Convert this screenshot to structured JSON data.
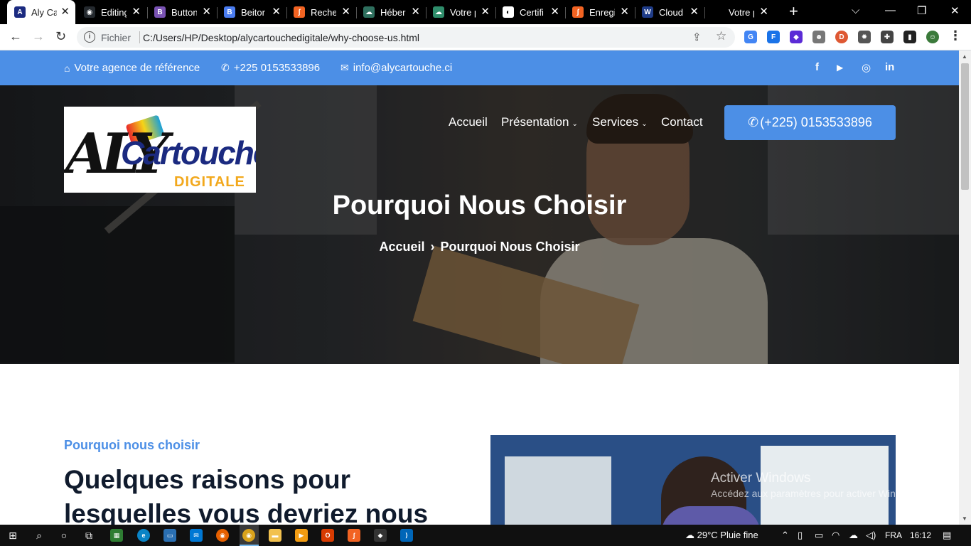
{
  "browser": {
    "tabs": [
      {
        "title": "Aly Ca",
        "favicon_color": "#1b2a80",
        "favicon_glyph": "A",
        "active": true
      },
      {
        "title": "Editing",
        "favicon_color": "#24292e",
        "favicon_glyph": "◉",
        "active": false
      },
      {
        "title": "Button",
        "favicon_color": "#7952b3",
        "favicon_glyph": "B",
        "active": false
      },
      {
        "title": "Beitor",
        "favicon_color": "#4a7cf0",
        "favicon_glyph": "B",
        "active": false
      },
      {
        "title": "Recher",
        "favicon_color": "#f26322",
        "favicon_glyph": "ʃ",
        "active": false
      },
      {
        "title": "Héber",
        "favicon_color": "#2e6f5e",
        "favicon_glyph": "☁",
        "active": false
      },
      {
        "title": "Votre p",
        "favicon_color": "#2f8d6b",
        "favicon_glyph": "☁",
        "active": false
      },
      {
        "title": "Certifi",
        "favicon_color": "#ffffff",
        "favicon_glyph": "◐",
        "active": false
      },
      {
        "title": "Enregi",
        "favicon_color": "#f26322",
        "favicon_glyph": "ʃ",
        "active": false
      },
      {
        "title": "Cloud",
        "favicon_color": "#1f3c88",
        "favicon_glyph": "W",
        "active": false
      },
      {
        "title": "Votre p",
        "favicon_color": "#000000",
        "favicon_glyph": "",
        "active": false
      }
    ],
    "new_tab_glyph": "+",
    "window_controls": [
      "chevron-down",
      "minimize",
      "restore",
      "close"
    ],
    "omnibox": {
      "protocol": "Fichier",
      "url": "C:/Users/HP/Desktop/alycartouchedigitale/why-choose-us.html"
    },
    "extensions": [
      {
        "name": "translate-icon",
        "color": "#4285f4",
        "glyph": "G"
      },
      {
        "name": "flow-icon",
        "color": "#1a73e8",
        "glyph": "F"
      },
      {
        "name": "layers-icon",
        "color": "#5b2bd6",
        "glyph": "◆"
      },
      {
        "name": "face-icon",
        "color": "#777777",
        "glyph": "☻"
      },
      {
        "name": "duckduckgo-icon",
        "color": "#de5833",
        "glyph": "D"
      },
      {
        "name": "settings-ext-icon",
        "color": "#555555",
        "glyph": "✹"
      },
      {
        "name": "puzzle-icon",
        "color": "#444444",
        "glyph": "✚"
      },
      {
        "name": "sidepanel-icon",
        "color": "#222222",
        "glyph": "▮"
      },
      {
        "name": "profile-icon",
        "color": "#3b7a3b",
        "glyph": "☺"
      }
    ]
  },
  "site": {
    "topbar": {
      "tagline": "Votre agence de référence",
      "phone": "+225 0153533896",
      "email": "info@alycartouche.ci",
      "social": [
        "f",
        "▶",
        "◎",
        "in"
      ]
    },
    "logo": {
      "aly": "ALY",
      "cartouche": "Cartouche",
      "digitale": "DIGITALE"
    },
    "nav": {
      "items": [
        {
          "label": "Accueil",
          "dropdown": false
        },
        {
          "label": "Présentation",
          "dropdown": true
        },
        {
          "label": "Services",
          "dropdown": true
        },
        {
          "label": "Contact",
          "dropdown": false
        }
      ],
      "call_button": "(+225) 0153533896"
    },
    "hero": {
      "title": "Pourquoi Nous Choisir",
      "breadcrumb": [
        "Accueil",
        "Pourquoi Nous Choisir"
      ]
    },
    "section": {
      "subheading": "Pourquoi nous choisir",
      "title": "Quelques raisons pour lesquelles vous devriez nous choisir"
    },
    "watermark": {
      "title": "Activer Windows",
      "subtitle": "Accédez aux paramètres pour activer Windows."
    }
  },
  "taskbar": {
    "weather": "29°C  Pluie fine",
    "language": "FRA",
    "time": "16:12"
  }
}
